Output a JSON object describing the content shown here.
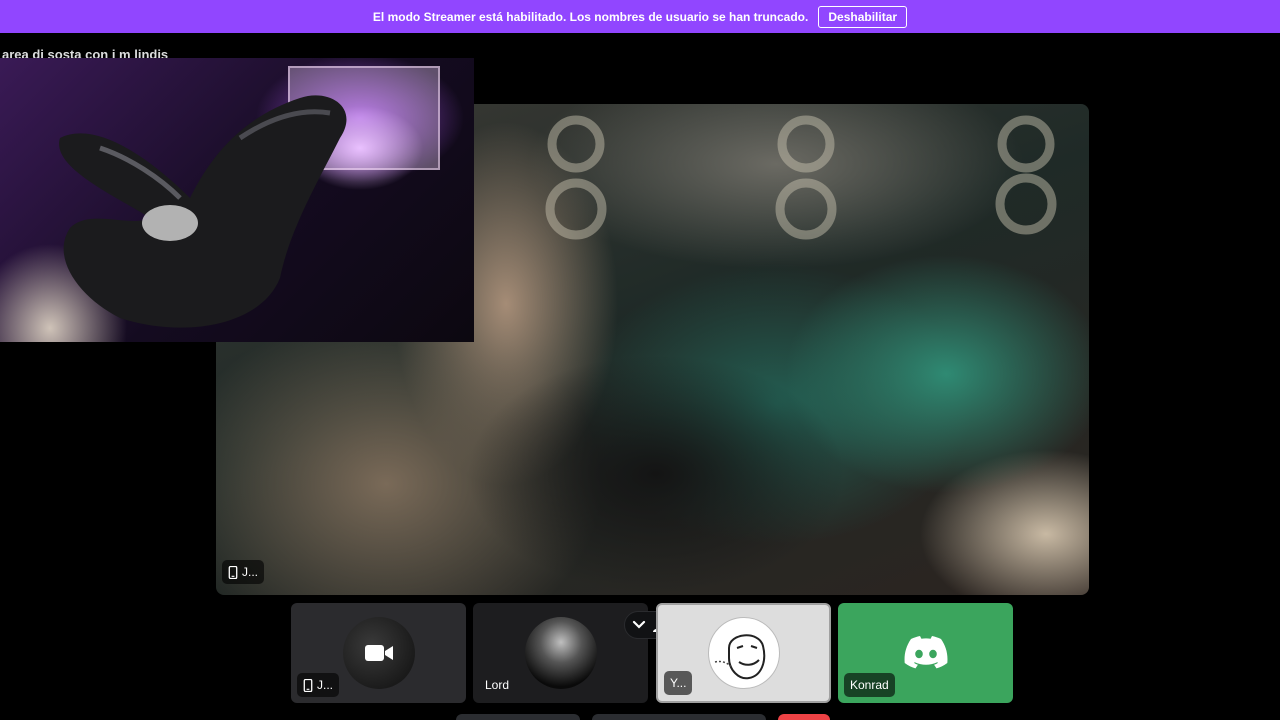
{
  "banner": {
    "message": "El modo Streamer está habilitado. Los nombres de usuario se han truncado.",
    "button_label": "Deshabilitar"
  },
  "channel": {
    "title": "area di sosta con i m lindis"
  },
  "main_stage": {
    "user_tag": "J..."
  },
  "tiles": [
    {
      "name": "J...",
      "icon": "video-camera-icon",
      "has_device_icon": true
    },
    {
      "name": "Lord"
    },
    {
      "name": "Y..."
    },
    {
      "name": "Konrad",
      "icon": "discord-logo-icon"
    }
  ],
  "colors": {
    "streamer_banner": "#9146ff",
    "discord_green": "#3ba55d",
    "tile_background": "#202225"
  }
}
